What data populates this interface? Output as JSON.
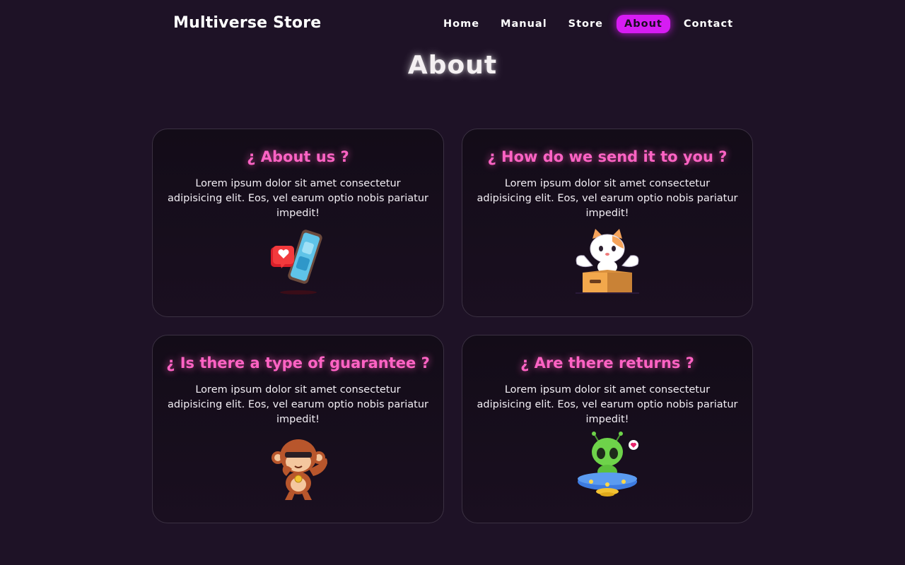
{
  "header": {
    "brand": "Multiverse Store",
    "nav": [
      {
        "label": "Home",
        "active": false
      },
      {
        "label": "Manual",
        "active": false
      },
      {
        "label": "Store",
        "active": false
      },
      {
        "label": "About",
        "active": true
      },
      {
        "label": "Contact",
        "active": false
      }
    ],
    "accent_color": "#d61cf3"
  },
  "page": {
    "title": "About"
  },
  "cards": [
    {
      "title": "¿ About us ?",
      "text": "Lorem ipsum dolor sit amet consectetur adipisicing elit. Eos, vel earum optio nobis pariatur impedit!",
      "illustration": "phone-heart-illustration"
    },
    {
      "title": "¿ How do we send it to you ?",
      "text": "Lorem ipsum dolor sit amet consectetur adipisicing elit. Eos, vel earum optio nobis pariatur impedit!",
      "illustration": "cat-in-box-illustration"
    },
    {
      "title": "¿ Is there a type of guarantee ?",
      "text": "Lorem ipsum dolor sit amet consectetur adipisicing elit. Eos, vel earum optio nobis pariatur impedit!",
      "illustration": "monkey-dab-illustration"
    },
    {
      "title": "¿ Are there returns ?",
      "text": "Lorem ipsum dolor sit amet consectetur adipisicing elit. Eos, vel earum optio nobis pariatur impedit!",
      "illustration": "alien-ufo-illustration"
    }
  ],
  "colors": {
    "background": "#1e1226",
    "card_title": "#ff63c4",
    "card_border": "#3b3142"
  }
}
